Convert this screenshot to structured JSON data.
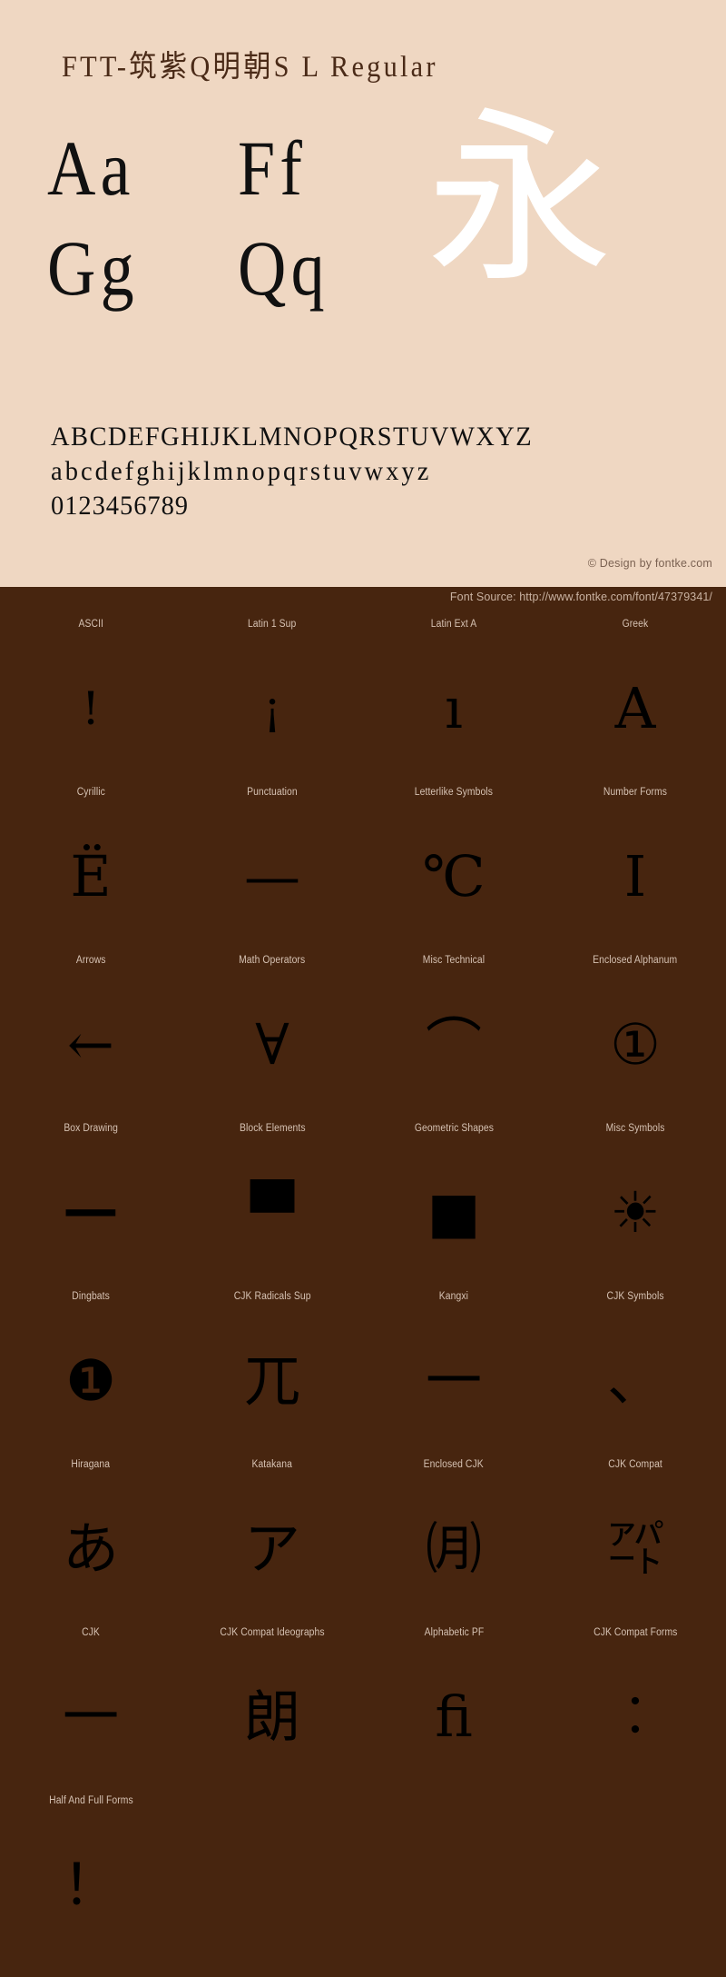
{
  "hero": {
    "title": "FTT-筑紫Q明朝S L Regular",
    "sample_rows": [
      {
        "pair_1": "Aa",
        "pair_2": "Ff"
      },
      {
        "pair_1": "Gg",
        "pair_2": "Qq"
      }
    ],
    "cjk_showcase_glyph": "永",
    "alphabet_upper": "ABCDEFGHIJKLMNOPQRSTUVWXYZ",
    "alphabet_lower": "abcdefghijklmnopqrstuvwxyz",
    "digits": "0123456789",
    "credit": "© Design by fontke.com",
    "bg_color": "#EFD7C2",
    "text_color": "#111111",
    "showcase_color": "#FFFFFF"
  },
  "blocks_panel": {
    "source": "Font Source: http://www.fontke.com/font/47379341/",
    "bg_color": "#47250F",
    "label_color": "#D6C2B3",
    "glyph_color": "#000000",
    "cells": [
      {
        "label": "ASCII",
        "glyph": "!",
        "size": "tiny"
      },
      {
        "label": "Latin 1 Sup",
        "glyph": "¡",
        "size": "tiny"
      },
      {
        "label": "Latin Ext A",
        "glyph": "ı",
        "size": "small"
      },
      {
        "label": "Greek",
        "glyph": "Α",
        "size": "small"
      },
      {
        "label": "Cyrillic",
        "glyph": "Ё",
        "size": "small"
      },
      {
        "label": "Punctuation",
        "glyph": "—",
        "size": "small"
      },
      {
        "label": "Letterlike Symbols",
        "glyph": "℃",
        "size": "small"
      },
      {
        "label": "Number Forms",
        "glyph": "Ⅰ",
        "size": "small"
      },
      {
        "label": "Arrows",
        "glyph": "←",
        "size": "small"
      },
      {
        "label": "Math Operators",
        "glyph": "∀",
        "size": "small"
      },
      {
        "label": "Misc Technical",
        "glyph": "⌒",
        "size": "small"
      },
      {
        "label": "Enclosed Alphanum",
        "glyph": "①",
        "size": "small"
      },
      {
        "label": "Box Drawing",
        "glyph": "─",
        "size": "wide"
      },
      {
        "label": "Block Elements",
        "glyph": "▀",
        "size": "small"
      },
      {
        "label": "Geometric Shapes",
        "glyph": "■",
        "size": "small"
      },
      {
        "label": "Misc Symbols",
        "glyph": "☀",
        "size": "small"
      },
      {
        "label": "Dingbats",
        "glyph": "❶",
        "size": "small"
      },
      {
        "label": "CJK Radicals Sup",
        "glyph": "兀",
        "size": "small"
      },
      {
        "label": "Kangxi",
        "glyph": "⼀",
        "size": "small"
      },
      {
        "label": "CJK Symbols",
        "glyph": "、",
        "size": "small"
      },
      {
        "label": "Hiragana",
        "glyph": "あ",
        "size": "small"
      },
      {
        "label": "Katakana",
        "glyph": "ア",
        "size": "small"
      },
      {
        "label": "Enclosed CJK",
        "glyph": "㈪",
        "size": "small"
      },
      {
        "label": "CJK Compat",
        "glyph": "㌀",
        "size": "small"
      },
      {
        "label": "CJK",
        "glyph": "一",
        "size": "small"
      },
      {
        "label": "CJK Compat Ideographs",
        "glyph": "朗",
        "size": "small"
      },
      {
        "label": "Alphabetic PF",
        "glyph": "ﬁ",
        "size": "small"
      },
      {
        "label": "CJK Compat Forms",
        "glyph": "︰",
        "size": "small"
      },
      {
        "label": "Half And Full Forms",
        "glyph": "！",
        "size": "small"
      },
      {
        "label": "",
        "glyph": "",
        "size": "small",
        "empty": true
      },
      {
        "label": "",
        "glyph": "",
        "size": "small",
        "empty": true
      },
      {
        "label": "",
        "glyph": "",
        "size": "small",
        "empty": true
      }
    ]
  }
}
